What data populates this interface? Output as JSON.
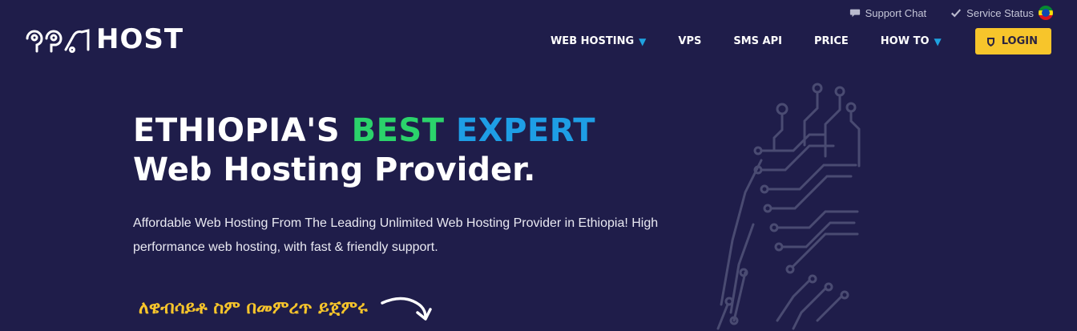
{
  "utility": {
    "support_chat": "Support Chat",
    "service_status": "Service Status",
    "flag_icon": "ethiopia-flag-icon"
  },
  "logo": {
    "text": "HOST"
  },
  "nav": {
    "items": [
      {
        "label": "WEB HOSTING",
        "dropdown": true
      },
      {
        "label": "VPS",
        "dropdown": false
      },
      {
        "label": "SMS API",
        "dropdown": false
      },
      {
        "label": "PRICE",
        "dropdown": false
      },
      {
        "label": "HOW TO",
        "dropdown": true
      }
    ],
    "login": "LOGIN"
  },
  "hero": {
    "title_part1": "ETHIOPIA'S ",
    "title_part2": "BEST ",
    "title_part3": "EXPERT",
    "title_line2": "Web Hosting Provider.",
    "subtitle": "Affordable Web Hosting From The Leading Unlimited Web Hosting Provider in Ethiopia! High performance web hosting, with fast & friendly support.",
    "amharic_cta": "ለዌብሳይቶ ስም በመምረጥ ይጀምሩ"
  },
  "colors": {
    "background": "#1f1d4a",
    "accent_green": "#2bd36b",
    "accent_blue": "#1e9ee5",
    "accent_yellow": "#f7c52b"
  }
}
